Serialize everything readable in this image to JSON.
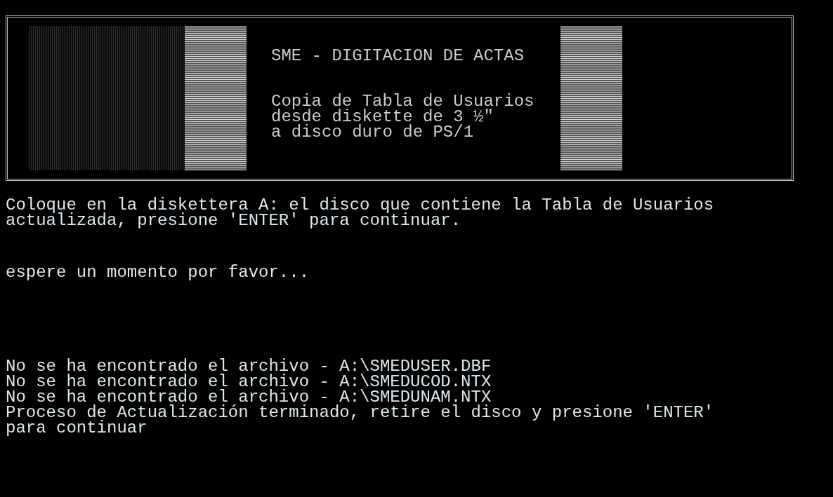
{
  "banner": {
    "title": "SME - DIGITACION DE ACTAS",
    "lines": [
      "Copia de Tabla de Usuarios",
      "desde diskette de 3 ½\"",
      "a disco duro de PS/1"
    ]
  },
  "messages": [
    {
      "lines": [
        "Coloque en la diskettera A: el disco que contiene la Tabla de Usuarios",
        "actualizada, presione 'ENTER' para continuar."
      ]
    },
    {
      "lines": [
        "espere un momento por favor..."
      ]
    },
    {
      "lines": [
        "No se ha encontrado el archivo - A:\\SMEDUSER.DBF",
        "No se ha encontrado el archivo - A:\\SMEDUCOD.NTX",
        "No se ha encontrado el archivo - A:\\SMEDUNAM.NTX",
        "Proceso de Actualización terminado, retire el disco y presione 'ENTER'",
        "para continuar"
      ]
    }
  ]
}
